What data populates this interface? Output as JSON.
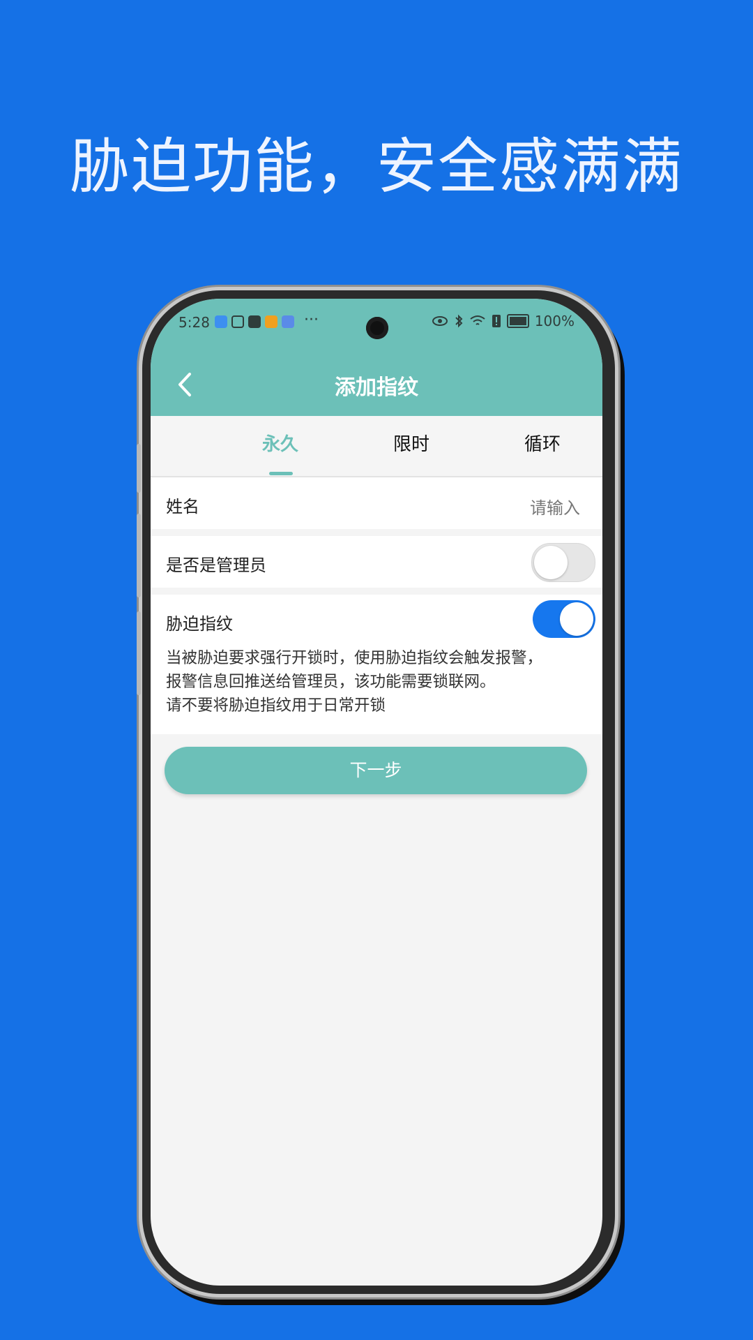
{
  "headline": "胁迫功能，安全感满满",
  "status_bar": {
    "time": "5:28",
    "more": "···",
    "battery_text": "100%"
  },
  "nav": {
    "title": "添加指纹"
  },
  "tabs": [
    {
      "label": "永久",
      "active": true
    },
    {
      "label": "限时",
      "active": false
    },
    {
      "label": "循环",
      "active": false
    }
  ],
  "form": {
    "name_label": "姓名",
    "name_placeholder": "请输入",
    "admin_label": "是否是管理员",
    "admin_on": false,
    "duress_label": "胁迫指纹",
    "duress_on": true,
    "duress_desc": [
      "当被胁迫要求强行开锁时，使用胁迫指纹会触发报警，",
      "报警信息回推送给管理员，该功能需要锁联网。",
      "请不要将胁迫指纹用于日常开锁"
    ]
  },
  "next_button": "下一步",
  "colors": {
    "background": "#1571E6",
    "header": "#6CC0B8",
    "toggle_on": "#1677EE",
    "toggle_off": "#E6E6E6"
  }
}
